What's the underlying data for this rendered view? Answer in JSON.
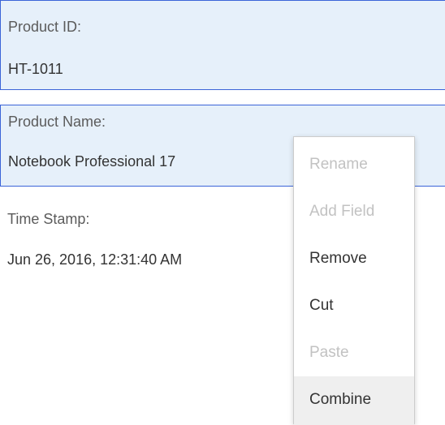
{
  "fields": [
    {
      "label": "Product ID:",
      "value": "HT-1011"
    },
    {
      "label": "Product Name:",
      "value": "Notebook Professional 17"
    },
    {
      "label": "Time Stamp:",
      "value": "Jun 26, 2016, 12:31:40 AM"
    }
  ],
  "context_menu": {
    "items": [
      {
        "label": "Rename",
        "enabled": false
      },
      {
        "label": "Add Field",
        "enabled": false
      },
      {
        "label": "Remove",
        "enabled": true
      },
      {
        "label": "Cut",
        "enabled": true
      },
      {
        "label": "Paste",
        "enabled": false
      },
      {
        "label": "Combine",
        "enabled": true,
        "highlighted": true
      }
    ]
  },
  "colors": {
    "selection_background": "#e6f0fa",
    "selection_border": "#3b64d8",
    "disabled_text": "#c2c2c2",
    "highlight_background": "#efefef"
  }
}
